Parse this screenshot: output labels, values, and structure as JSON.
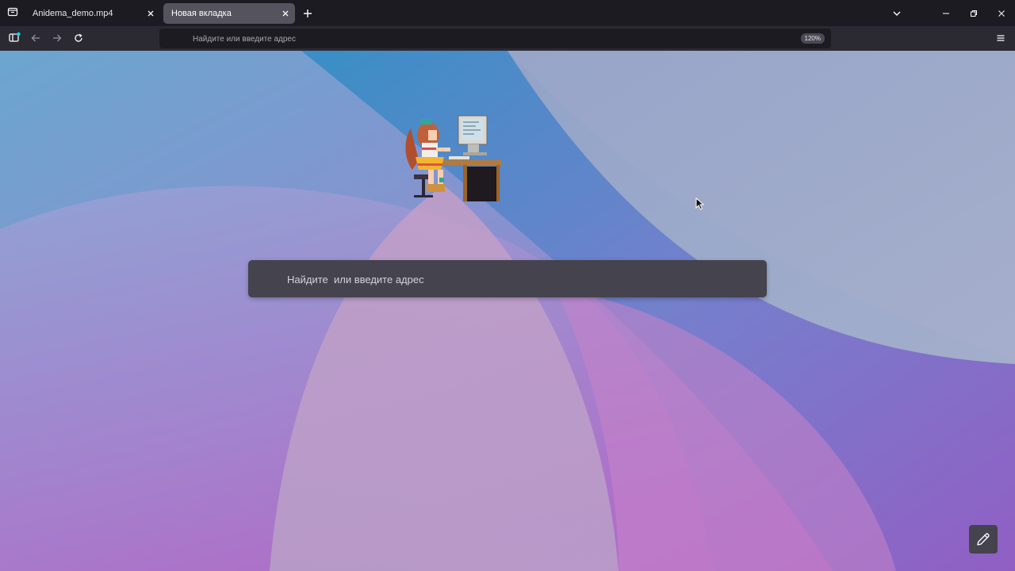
{
  "browser": {
    "tabs": [
      {
        "title": "Anidema_demo.mp4",
        "active": false
      },
      {
        "title": "Новая вкладка",
        "active": true
      }
    ],
    "icons": {
      "tab_list": "tab-list-icon",
      "close": "close-icon",
      "new_tab": "plus-icon",
      "list_all_tabs": "chevron-down-icon",
      "minimize": "minimize-icon",
      "restore": "restore-icon",
      "window_close": "close-icon"
    }
  },
  "navbar": {
    "address_placeholder": "Найдите или введите адрес",
    "zoom": "120%",
    "icons": [
      "sidebar-icon",
      "back-arrow-icon",
      "forward-arrow-icon",
      "reload-icon",
      "menu-icon"
    ]
  },
  "newtab": {
    "search_placeholder": "Найдите  или введите адрес",
    "edit_icon": "pencil-icon"
  },
  "colors": {
    "chrome_dark": "#1c1b22",
    "toolbar": "#2b2a33",
    "active_tab": "#55535e",
    "search_box": "#45434d",
    "accent_dot": "#0df"
  }
}
